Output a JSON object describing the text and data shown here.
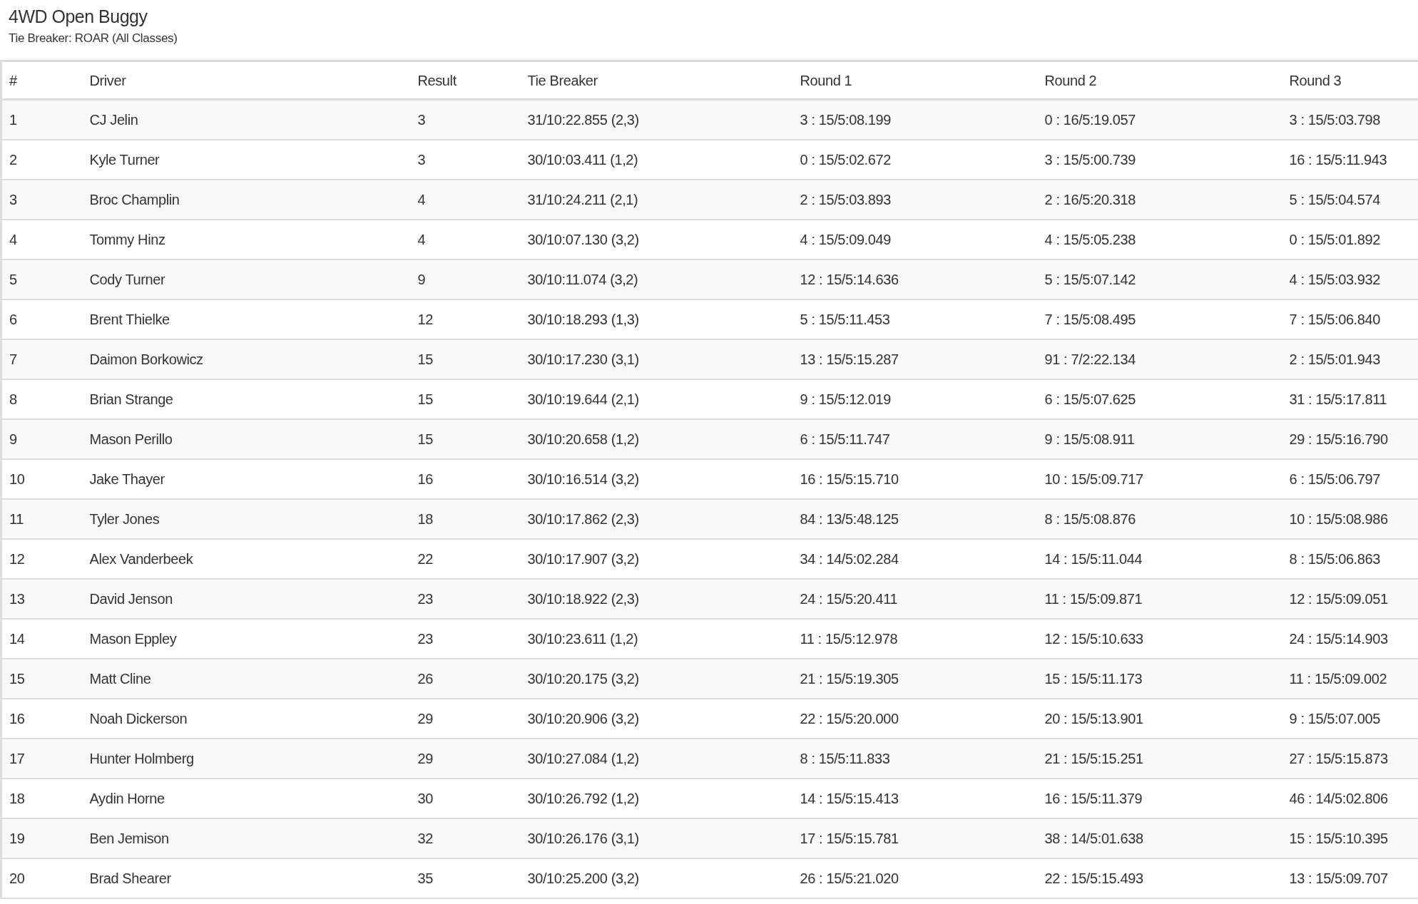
{
  "title": "4WD Open Buggy",
  "subtitle": "Tie Breaker: ROAR (All Classes)",
  "columns": [
    "#",
    "Driver",
    "Result",
    "Tie Breaker",
    "Round 1",
    "Round 2",
    "Round 3"
  ],
  "rows": [
    [
      "1",
      "CJ Jelin",
      "3",
      "31/10:22.855 (2,3)",
      "3 : 15/5:08.199",
      "0 : 16/5:19.057",
      "3 : 15/5:03.798"
    ],
    [
      "2",
      "Kyle Turner",
      "3",
      "30/10:03.411 (1,2)",
      "0 : 15/5:02.672",
      "3 : 15/5:00.739",
      "16 : 15/5:11.943"
    ],
    [
      "3",
      "Broc Champlin",
      "4",
      "31/10:24.211 (2,1)",
      "2 : 15/5:03.893",
      "2 : 16/5:20.318",
      "5 : 15/5:04.574"
    ],
    [
      "4",
      "Tommy Hinz",
      "4",
      "30/10:07.130 (3,2)",
      "4 : 15/5:09.049",
      "4 : 15/5:05.238",
      "0 : 15/5:01.892"
    ],
    [
      "5",
      "Cody Turner",
      "9",
      "30/10:11.074 (3,2)",
      "12 : 15/5:14.636",
      "5 : 15/5:07.142",
      "4 : 15/5:03.932"
    ],
    [
      "6",
      "Brent Thielke",
      "12",
      "30/10:18.293 (1,3)",
      "5 : 15/5:11.453",
      "7 : 15/5:08.495",
      "7 : 15/5:06.840"
    ],
    [
      "7",
      "Daimon Borkowicz",
      "15",
      "30/10:17.230 (3,1)",
      "13 : 15/5:15.287",
      "91 : 7/2:22.134",
      "2 : 15/5:01.943"
    ],
    [
      "8",
      "Brian Strange",
      "15",
      "30/10:19.644 (2,1)",
      "9 : 15/5:12.019",
      "6 : 15/5:07.625",
      "31 : 15/5:17.811"
    ],
    [
      "9",
      "Mason Perillo",
      "15",
      "30/10:20.658 (1,2)",
      "6 : 15/5:11.747",
      "9 : 15/5:08.911",
      "29 : 15/5:16.790"
    ],
    [
      "10",
      "Jake Thayer",
      "16",
      "30/10:16.514 (3,2)",
      "16 : 15/5:15.710",
      "10 : 15/5:09.717",
      "6 : 15/5:06.797"
    ],
    [
      "11",
      "Tyler Jones",
      "18",
      "30/10:17.862 (2,3)",
      "84 : 13/5:48.125",
      "8 : 15/5:08.876",
      "10 : 15/5:08.986"
    ],
    [
      "12",
      "Alex Vanderbeek",
      "22",
      "30/10:17.907 (3,2)",
      "34 : 14/5:02.284",
      "14 : 15/5:11.044",
      "8 : 15/5:06.863"
    ],
    [
      "13",
      "David Jenson",
      "23",
      "30/10:18.922 (2,3)",
      "24 : 15/5:20.411",
      "11 : 15/5:09.871",
      "12 : 15/5:09.051"
    ],
    [
      "14",
      "Mason Eppley",
      "23",
      "30/10:23.611 (1,2)",
      "11 : 15/5:12.978",
      "12 : 15/5:10.633",
      "24 : 15/5:14.903"
    ],
    [
      "15",
      "Matt Cline",
      "26",
      "30/10:20.175 (3,2)",
      "21 : 15/5:19.305",
      "15 : 15/5:11.173",
      "11 : 15/5:09.002"
    ],
    [
      "16",
      "Noah Dickerson",
      "29",
      "30/10:20.906 (3,2)",
      "22 : 15/5:20.000",
      "20 : 15/5:13.901",
      "9 : 15/5:07.005"
    ],
    [
      "17",
      "Hunter Holmberg",
      "29",
      "30/10:27.084 (1,2)",
      "8 : 15/5:11.833",
      "21 : 15/5:15.251",
      "27 : 15/5:15.873"
    ],
    [
      "18",
      "Aydin Horne",
      "30",
      "30/10:26.792 (1,2)",
      "14 : 15/5:15.413",
      "16 : 15/5:11.379",
      "46 : 14/5:02.806"
    ],
    [
      "19",
      "Ben Jemison",
      "32",
      "30/10:26.176 (3,1)",
      "17 : 15/5:15.781",
      "38 : 14/5:01.638",
      "15 : 15/5:10.395"
    ],
    [
      "20",
      "Brad Shearer",
      "35",
      "30/10:25.200 (3,2)",
      "26 : 15/5:21.020",
      "22 : 15/5:15.493",
      "13 : 15/5:09.707"
    ]
  ]
}
